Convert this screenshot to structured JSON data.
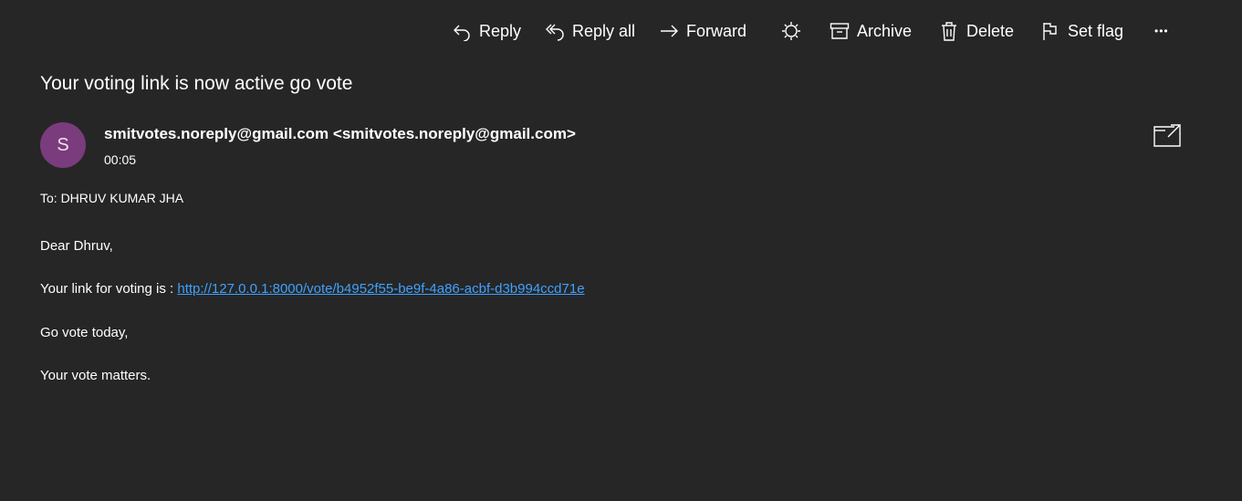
{
  "toolbar": {
    "reply_label": "Reply",
    "reply_all_label": "Reply all",
    "forward_label": "Forward",
    "archive_label": "Archive",
    "delete_label": "Delete",
    "set_flag_label": "Set flag",
    "more_label": "•••"
  },
  "message": {
    "subject": "Your voting link is now active go vote",
    "avatar_initial": "S",
    "sender_name": "smitvotes.noreply@gmail.com",
    "sender_address": "<smitvotes.noreply@gmail.com>",
    "time": "00:05",
    "to": "To: DHRUV KUMAR JHA",
    "greeting": "Dear Dhruv,",
    "link_prefix": "Your link for voting is : ",
    "link_url": "http://127.0.0.1:8000/vote/b4952f55-be9f-4a86-acbf-d3b994ccd71e",
    "line3": "Go vote today,",
    "line4": "Your vote matters."
  },
  "colors": {
    "background": "#262626",
    "avatar": "#7a3c7c",
    "link": "#3ea2ff"
  },
  "icons": [
    "reply-icon",
    "reply-all-icon",
    "forward-icon",
    "theme-icon",
    "archive-icon",
    "delete-icon",
    "flag-icon",
    "more-icon",
    "popout-icon"
  ]
}
